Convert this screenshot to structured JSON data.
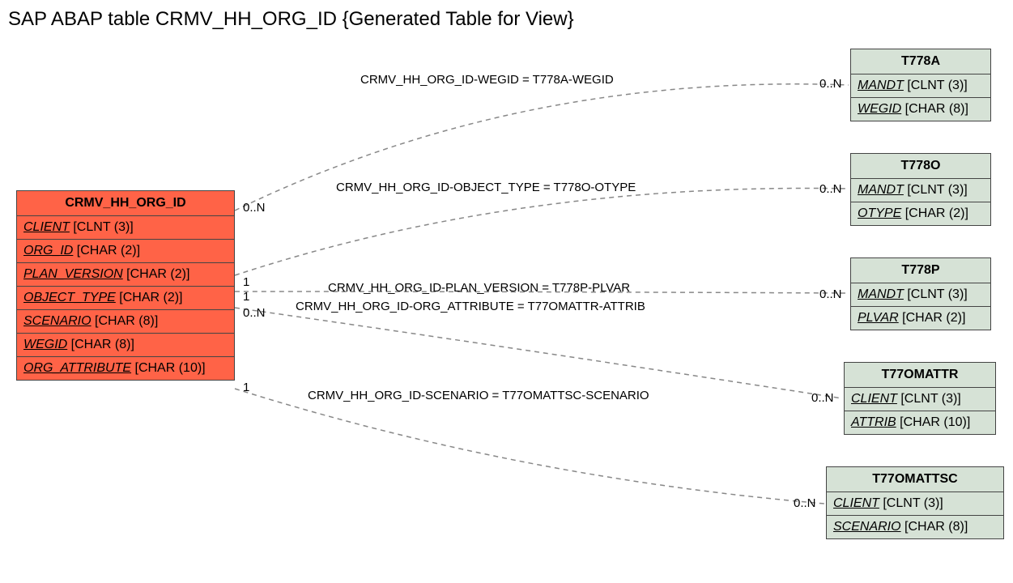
{
  "title": "SAP ABAP table CRMV_HH_ORG_ID {Generated Table for View}",
  "main_table": {
    "name": "CRMV_HH_ORG_ID",
    "fields": [
      {
        "name": "CLIENT",
        "type": "[CLNT (3)]"
      },
      {
        "name": "ORG_ID",
        "type": "[CHAR (2)]"
      },
      {
        "name": "PLAN_VERSION",
        "type": "[CHAR (2)]"
      },
      {
        "name": "OBJECT_TYPE",
        "type": "[CHAR (2)]"
      },
      {
        "name": "SCENARIO",
        "type": "[CHAR (8)]"
      },
      {
        "name": "WEGID",
        "type": "[CHAR (8)]"
      },
      {
        "name": "ORG_ATTRIBUTE",
        "type": "[CHAR (10)]"
      }
    ]
  },
  "ref_tables": [
    {
      "name": "T778A",
      "fields": [
        {
          "name": "MANDT",
          "type": "[CLNT (3)]"
        },
        {
          "name": "WEGID",
          "type": "[CHAR (8)]"
        }
      ]
    },
    {
      "name": "T778O",
      "fields": [
        {
          "name": "MANDT",
          "type": "[CLNT (3)]"
        },
        {
          "name": "OTYPE",
          "type": "[CHAR (2)]"
        }
      ]
    },
    {
      "name": "T778P",
      "fields": [
        {
          "name": "MANDT",
          "type": "[CLNT (3)]"
        },
        {
          "name": "PLVAR",
          "type": "[CHAR (2)]"
        }
      ]
    },
    {
      "name": "T77OMATTR",
      "fields": [
        {
          "name": "CLIENT",
          "type": "[CLNT (3)]"
        },
        {
          "name": "ATTRIB",
          "type": "[CHAR (10)]"
        }
      ]
    },
    {
      "name": "T77OMATTSC",
      "fields": [
        {
          "name": "CLIENT",
          "type": "[CLNT (3)]"
        },
        {
          "name": "SCENARIO",
          "type": "[CHAR (8)]"
        }
      ]
    }
  ],
  "relations": [
    {
      "label": "CRMV_HH_ORG_ID-WEGID = T778A-WEGID",
      "left_card": "0..N",
      "right_card": "0..N"
    },
    {
      "label": "CRMV_HH_ORG_ID-OBJECT_TYPE = T778O-OTYPE",
      "left_card": "",
      "right_card": "0..N"
    },
    {
      "label": "CRMV_HH_ORG_ID-PLAN_VERSION = T778P-PLVAR",
      "left_card": "1",
      "right_card": "0..N"
    },
    {
      "label": "CRMV_HH_ORG_ID-ORG_ATTRIBUTE = T77OMATTR-ATTRIB",
      "left_card": "1",
      "right_card": ""
    },
    {
      "label": "CRMV_HH_ORG_ID-SCENARIO = T77OMATTSC-SCENARIO",
      "left_card": "0..N",
      "right_card": "0..N"
    },
    {
      "label": "",
      "left_card": "1",
      "right_card": "0..N"
    }
  ]
}
